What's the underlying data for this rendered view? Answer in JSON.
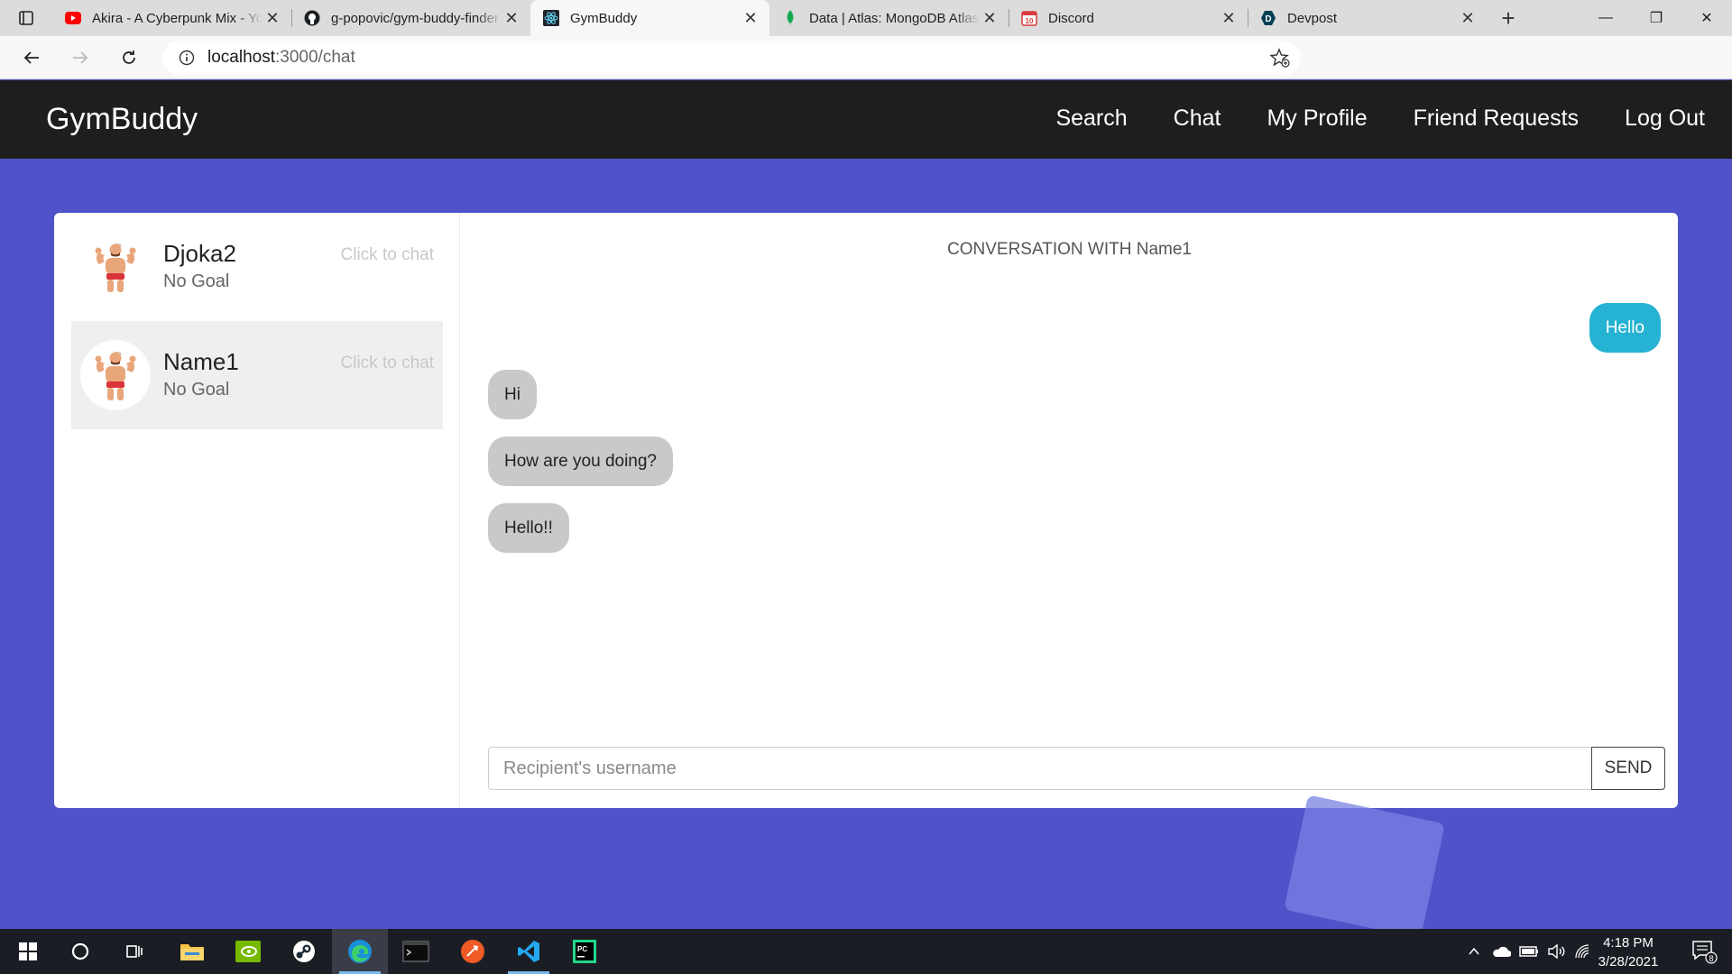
{
  "browser": {
    "tabs": [
      {
        "title": "Akira - A Cyberpunk Mix - YouTube",
        "icon": "youtube-icon"
      },
      {
        "title": "g-popovic/gym-buddy-finder",
        "icon": "github-icon"
      },
      {
        "title": "GymBuddy",
        "icon": "react-icon"
      },
      {
        "title": "Data | Atlas: MongoDB Atlas",
        "icon": "mongodb-leaf-icon"
      },
      {
        "title": "Discord",
        "icon": "calendar-icon",
        "badge": "10"
      },
      {
        "title": "Devpost",
        "icon": "devpost-icon",
        "icon_letter": "D"
      }
    ],
    "active_tab": 2,
    "url_host": "localhost",
    "url_path": ":3000/chat"
  },
  "app": {
    "brand": "GymBuddy",
    "nav": {
      "search": "Search",
      "chat": "Chat",
      "profile": "My Profile",
      "friend_requests": "Friend Requests",
      "logout": "Log Out"
    },
    "colors": {
      "background": "#4f52c9",
      "navbar": "#1e1e1e",
      "outgoing_bubble": "#26b3d3",
      "incoming_bubble": "#c9c9c9"
    }
  },
  "contacts": [
    {
      "name": "Djoka2",
      "goal": "No Goal",
      "hint": "Click to chat",
      "active": false
    },
    {
      "name": "Name1",
      "goal": "No Goal",
      "hint": "Click to chat",
      "active": true
    }
  ],
  "conversation": {
    "title": "CONVERSATION WITH Name1",
    "messages": [
      {
        "text": "Hello",
        "direction": "out"
      },
      {
        "text": "Hi",
        "direction": "in"
      },
      {
        "text": "How are you doing?",
        "direction": "in"
      },
      {
        "text": "Hello!!",
        "direction": "in"
      }
    ],
    "input_placeholder": "Recipient's username",
    "send_label": "SEND"
  },
  "taskbar": {
    "time": "4:18 PM",
    "date": "3/28/2021",
    "notifications": "8"
  }
}
